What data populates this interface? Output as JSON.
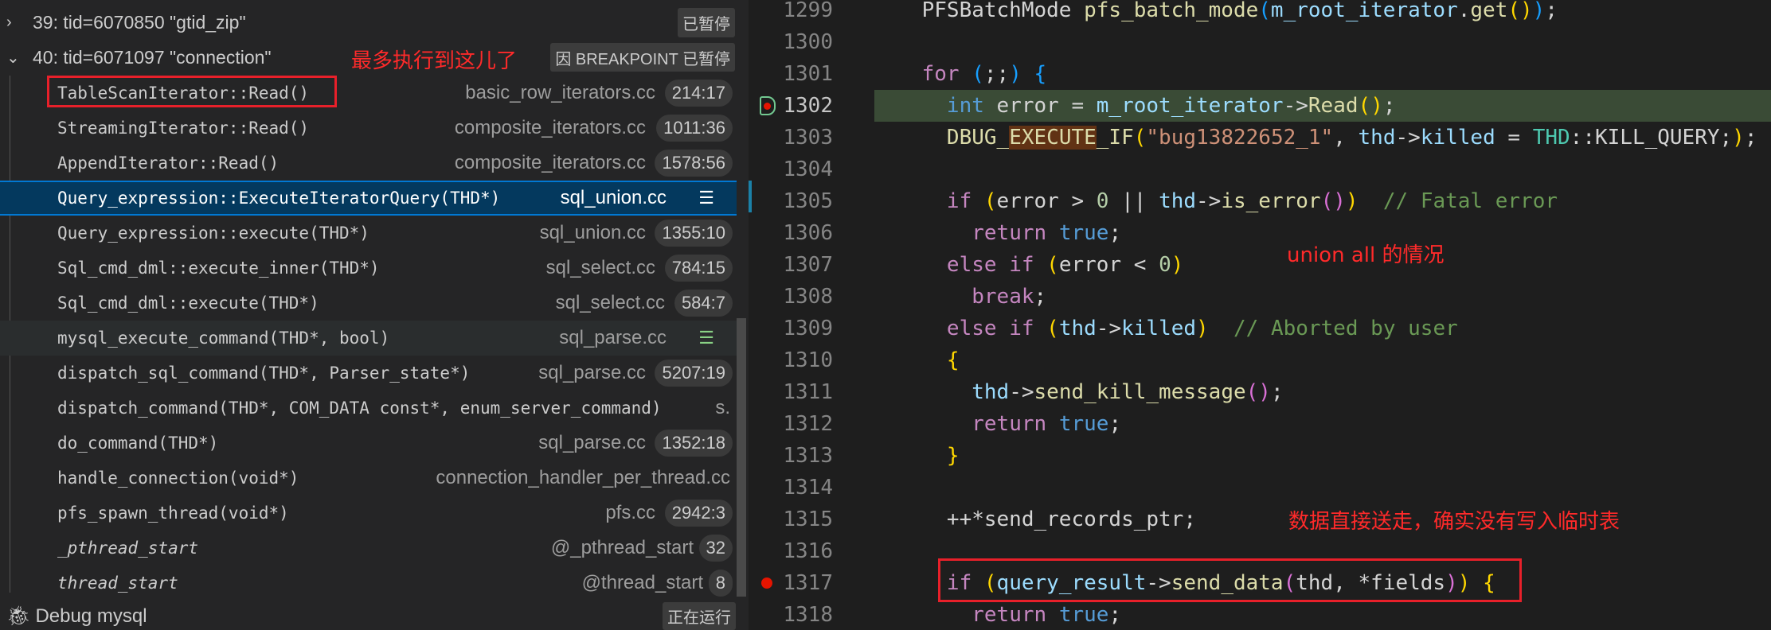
{
  "callstack": {
    "threads": [
      {
        "label": "39: tid=6070850 \"gtid_zip\"",
        "status": "已暂停",
        "expanded": false
      },
      {
        "label": "40: tid=6071097 \"connection\"",
        "status": "因 BREAKPOINT 已暂停",
        "expanded": true
      }
    ],
    "frames": [
      {
        "fn": "TableScanIterator::Read()",
        "file": "basic_row_iterators.cc",
        "line": "214:17"
      },
      {
        "fn": "StreamingIterator::Read()",
        "file": "composite_iterators.cc",
        "line": "1011:36"
      },
      {
        "fn": "AppendIterator::Read()",
        "file": "composite_iterators.cc",
        "line": "1578:56"
      },
      {
        "fn": "Query_expression::ExecuteIteratorQuery(THD*)",
        "file": "sql_union.cc",
        "line": "",
        "selected": true,
        "restart": true
      },
      {
        "fn": "Query_expression::execute(THD*)",
        "file": "sql_union.cc",
        "line": "1355:10"
      },
      {
        "fn": "Sql_cmd_dml::execute_inner(THD*)",
        "file": "sql_select.cc",
        "line": "784:15"
      },
      {
        "fn": "Sql_cmd_dml::execute(THD*)",
        "file": "sql_select.cc",
        "line": "584:7"
      },
      {
        "fn": "mysql_execute_command(THD*, bool)",
        "file": "sql_parse.cc",
        "line": "",
        "hover": true,
        "restart": true
      },
      {
        "fn": "dispatch_sql_command(THD*, Parser_state*)",
        "file": "sql_parse.cc",
        "line": "5207:19"
      },
      {
        "fn": "dispatch_command(THD*, COM_DATA const*, enum_server_command)",
        "file": "s.",
        "line": ""
      },
      {
        "fn": "do_command(THD*)",
        "file": "sql_parse.cc",
        "line": "1352:18"
      },
      {
        "fn": "handle_connection(void*)",
        "file": "connection_handler_per_thread.cc",
        "line": ""
      },
      {
        "fn": "pfs_spawn_thread(void*)",
        "file": "pfs.cc",
        "line": "2942:3"
      },
      {
        "fn": "_pthread_start",
        "file": "@_pthread_start",
        "line": "32",
        "italic": true
      },
      {
        "fn": "thread_start",
        "file": "@thread_start",
        "line": "8",
        "italic": true
      }
    ],
    "footer": {
      "label": "Debug mysql",
      "status": "正在运行"
    }
  },
  "annotations": {
    "max_reached": "最多执行到这儿了",
    "union_all": "union all 的情况",
    "direct_send": "数据直接送走，确实没有写入临时表"
  },
  "editor": {
    "lines": [
      {
        "n": "1299",
        "tokens": [
          [
            "    PFSBatchMode ",
            "pl"
          ],
          [
            "pfs_batch_mode",
            "fu"
          ],
          [
            "(",
            "b3"
          ],
          [
            "m_root_iterator",
            "va"
          ],
          [
            ".",
            "pl"
          ],
          [
            "get",
            "fu"
          ],
          [
            "(",
            "b1"
          ],
          [
            ")",
            "b1"
          ],
          [
            ")",
            "b3"
          ],
          [
            ";",
            "pl"
          ]
        ]
      },
      {
        "n": "1300",
        "tokens": []
      },
      {
        "n": "1301",
        "tokens": [
          [
            "    ",
            "pl"
          ],
          [
            "for",
            "kw"
          ],
          [
            " ",
            "pl"
          ],
          [
            "(",
            "b3"
          ],
          [
            ";;",
            "pl"
          ],
          [
            ")",
            "b3"
          ],
          [
            " ",
            "pl"
          ],
          [
            "{",
            "b3"
          ]
        ]
      },
      {
        "n": "1302",
        "current": true,
        "tokens": [
          [
            "      ",
            "pl"
          ],
          [
            "int",
            "ty"
          ],
          [
            " error = ",
            "pl"
          ],
          [
            "m_root_iterator",
            "va"
          ],
          [
            "->",
            "pl"
          ],
          [
            "Read",
            "fu"
          ],
          [
            "(",
            "b1"
          ],
          [
            ")",
            "b1"
          ],
          [
            ";",
            "pl"
          ]
        ]
      },
      {
        "n": "1303",
        "tokens": [
          [
            "      ",
            "pl"
          ],
          [
            "DBUG_",
            "mac"
          ],
          [
            "EXECUTE",
            "hl"
          ],
          [
            "_IF",
            "mac"
          ],
          [
            "(",
            "b1"
          ],
          [
            "\"bug13822652_1\"",
            "st"
          ],
          [
            ", ",
            "pl"
          ],
          [
            "thd",
            "va"
          ],
          [
            "->",
            "pl"
          ],
          [
            "killed",
            "va"
          ],
          [
            " = ",
            "pl"
          ],
          [
            "THD",
            "cls"
          ],
          [
            "::KILL_QUERY;",
            "pl"
          ],
          [
            ")",
            "b1"
          ],
          [
            ";",
            "pl"
          ]
        ]
      },
      {
        "n": "1304",
        "tokens": []
      },
      {
        "n": "1305",
        "tokens": [
          [
            "      ",
            "pl"
          ],
          [
            "if",
            "kw"
          ],
          [
            " ",
            "pl"
          ],
          [
            "(",
            "b1"
          ],
          [
            "error > ",
            "pl"
          ],
          [
            "0",
            "nu"
          ],
          [
            " || ",
            "pl"
          ],
          [
            "thd",
            "va"
          ],
          [
            "->",
            "pl"
          ],
          [
            "is_error",
            "fu"
          ],
          [
            "(",
            "b2"
          ],
          [
            ")",
            "b2"
          ],
          [
            ")",
            "b1"
          ],
          [
            "  ",
            "pl"
          ],
          [
            "// Fatal error",
            "cm"
          ]
        ]
      },
      {
        "n": "1306",
        "tokens": [
          [
            "        ",
            "pl"
          ],
          [
            "return",
            "kw"
          ],
          [
            " ",
            "pl"
          ],
          [
            "true",
            "ty"
          ],
          [
            ";",
            "pl"
          ]
        ]
      },
      {
        "n": "1307",
        "tokens": [
          [
            "      ",
            "pl"
          ],
          [
            "else",
            "kw"
          ],
          [
            " ",
            "pl"
          ],
          [
            "if",
            "kw"
          ],
          [
            " ",
            "pl"
          ],
          [
            "(",
            "b1"
          ],
          [
            "error < ",
            "pl"
          ],
          [
            "0",
            "nu"
          ],
          [
            ")",
            "b1"
          ]
        ]
      },
      {
        "n": "1308",
        "tokens": [
          [
            "        ",
            "pl"
          ],
          [
            "break",
            "kw"
          ],
          [
            ";",
            "pl"
          ]
        ]
      },
      {
        "n": "1309",
        "tokens": [
          [
            "      ",
            "pl"
          ],
          [
            "else",
            "kw"
          ],
          [
            " ",
            "pl"
          ],
          [
            "if",
            "kw"
          ],
          [
            " ",
            "pl"
          ],
          [
            "(",
            "b1"
          ],
          [
            "thd",
            "va"
          ],
          [
            "->",
            "pl"
          ],
          [
            "killed",
            "va"
          ],
          [
            ")",
            "b1"
          ],
          [
            "  ",
            "pl"
          ],
          [
            "// Aborted by user",
            "cm"
          ]
        ]
      },
      {
        "n": "1310",
        "tokens": [
          [
            "      ",
            "pl"
          ],
          [
            "{",
            "b1"
          ]
        ]
      },
      {
        "n": "1311",
        "tokens": [
          [
            "        ",
            "pl"
          ],
          [
            "thd",
            "va"
          ],
          [
            "->",
            "pl"
          ],
          [
            "send_kill_message",
            "fu"
          ],
          [
            "(",
            "b2"
          ],
          [
            ")",
            "b2"
          ],
          [
            ";",
            "pl"
          ]
        ]
      },
      {
        "n": "1312",
        "tokens": [
          [
            "        ",
            "pl"
          ],
          [
            "return",
            "kw"
          ],
          [
            " ",
            "pl"
          ],
          [
            "true",
            "ty"
          ],
          [
            ";",
            "pl"
          ]
        ]
      },
      {
        "n": "1313",
        "tokens": [
          [
            "      ",
            "pl"
          ],
          [
            "}",
            "b1"
          ]
        ]
      },
      {
        "n": "1314",
        "tokens": []
      },
      {
        "n": "1315",
        "tokens": [
          [
            "      ++*send_records_ptr;",
            "pl"
          ]
        ]
      },
      {
        "n": "1316",
        "tokens": []
      },
      {
        "n": "1317",
        "breakpoint": true,
        "tokens": [
          [
            "      ",
            "pl"
          ],
          [
            "if",
            "kw"
          ],
          [
            " ",
            "pl"
          ],
          [
            "(",
            "b1"
          ],
          [
            "query_result",
            "va"
          ],
          [
            "->",
            "pl"
          ],
          [
            "send_data",
            "fu"
          ],
          [
            "(",
            "b2"
          ],
          [
            "thd, *fields",
            "pl"
          ],
          [
            ")",
            "b2"
          ],
          [
            ")",
            "b1"
          ],
          [
            " ",
            "pl"
          ],
          [
            "{",
            "b1"
          ]
        ]
      },
      {
        "n": "1318",
        "tokens": [
          [
            "        ",
            "pl"
          ],
          [
            "return",
            "kw"
          ],
          [
            " ",
            "pl"
          ],
          [
            "true",
            "ty"
          ],
          [
            ";",
            "pl"
          ]
        ]
      }
    ]
  }
}
